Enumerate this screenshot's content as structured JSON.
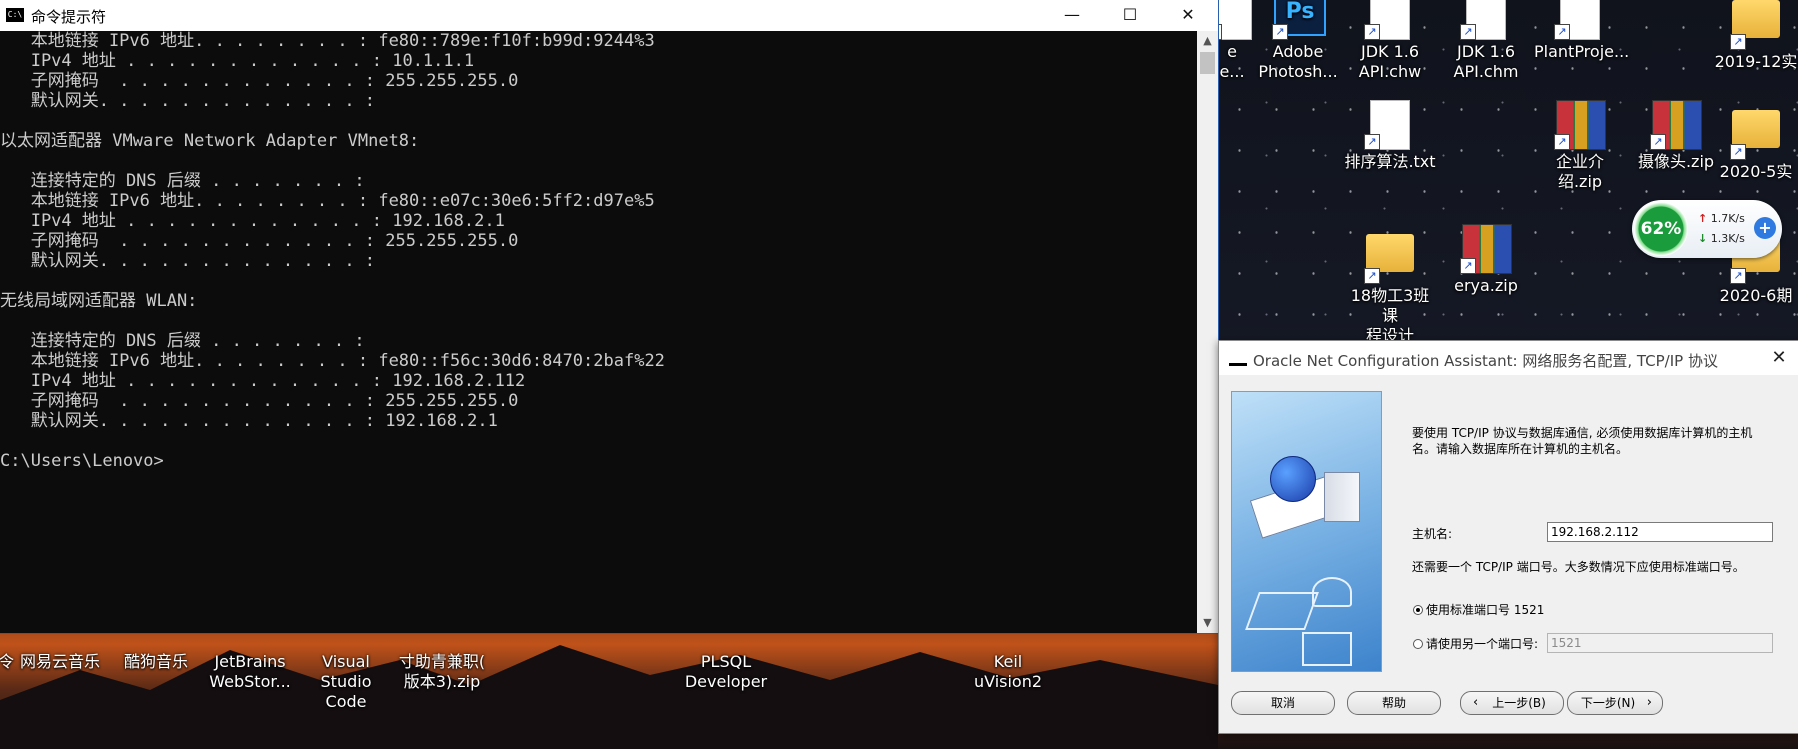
{
  "cmd": {
    "title": "命令提示符",
    "icon_text": "C:\\",
    "controls": {
      "minimize": "—",
      "maximize": "☐",
      "close": "✕"
    },
    "lines": [
      "   本地链接 IPv6 地址. . . . . . . . : fe80::789e:f10f:b99d:9244%3",
      "   IPv4 地址 . . . . . . . . . . . . : 10.1.1.1",
      "   子网掩码  . . . . . . . . . . . . : 255.255.255.0",
      "   默认网关. . . . . . . . . . . . . :",
      "",
      "以太网适配器 VMware Network Adapter VMnet8:",
      "",
      "   连接特定的 DNS 后缀 . . . . . . . :",
      "   本地链接 IPv6 地址. . . . . . . . : fe80::e07c:30e6:5ff2:d97e%5",
      "   IPv4 地址 . . . . . . . . . . . . : 192.168.2.1",
      "   子网掩码  . . . . . . . . . . . . : 255.255.255.0",
      "   默认网关. . . . . . . . . . . . . :",
      "",
      "无线局域网适配器 WLAN:",
      "",
      "   连接特定的 DNS 后缀 . . . . . . . :",
      "   本地链接 IPv6 地址. . . . . . . . : fe80::f56c:30d6:8470:2baf%22",
      "   IPv4 地址 . . . . . . . . . . . . : 192.168.2.112",
      "   子网掩码  . . . . . . . . . . . . : 255.255.255.0",
      "   默认网关. . . . . . . . . . . . . : 192.168.2.1",
      "",
      "C:\\Users\\Lenovo>"
    ]
  },
  "desktop_right": [
    {
      "label": "e\ne...",
      "type": "doc"
    },
    {
      "label": "Adobe\nPhotosh...",
      "type": "ps"
    },
    {
      "label": "JDK 1.6\nAPI.chw",
      "type": "doc"
    },
    {
      "label": "JDK 1.6\nAPI.chm",
      "type": "doc"
    },
    {
      "label": "PlantProje...",
      "type": "doc"
    },
    {
      "label": "2019-12实",
      "type": "folder"
    },
    {
      "label": "排序算法.txt",
      "type": "doc"
    },
    {
      "label": "企业介绍.zip",
      "type": "zip"
    },
    {
      "label": "摄像头.zip",
      "type": "zip"
    },
    {
      "label": "2020-5实",
      "type": "folder"
    },
    {
      "label": "18物工3班课\n程设计",
      "type": "folder"
    },
    {
      "label": "erya.zip",
      "type": "zip"
    },
    {
      "label": "2020-6期",
      "type": "folder"
    }
  ],
  "desktop_bottom": [
    {
      "label": "令"
    },
    {
      "label": "网易云音乐"
    },
    {
      "label": "酷狗音乐"
    },
    {
      "label": "JetBrains\nWebStor..."
    },
    {
      "label": "Visual\nStudio Code"
    },
    {
      "label": "寸助青兼职(\n版本3).zip"
    },
    {
      "label": "PLSQL\nDeveloper"
    },
    {
      "label": "Keil\nuVision2"
    }
  ],
  "network_widget": {
    "percent": "62%",
    "up": "1.7K/s",
    "down": "1.3K/s",
    "plus": "+"
  },
  "dialog": {
    "title": "Oracle Net Configuration Assistant: 网络服务名配置, TCP/IP 协议",
    "close": "✕",
    "intro_line1": "要使用 TCP/IP 协议与数据库通信, 必须使用数据库计算机的主机",
    "intro_line2": "名。请输入数据库所在计算机的主机名。",
    "host_label": "主机名:",
    "host_value": "192.168.2.112",
    "port_note": "还需要一个 TCP/IP 端口号。大多数情况下应使用标准端口号。",
    "radio_standard": "使用标准端口号 1521",
    "radio_other": "请使用另一个端口号:",
    "port_value": "1521",
    "buttons": {
      "cancel": "取消",
      "help": "帮助",
      "back": "上一步(B)",
      "next": "下一步(N)"
    }
  }
}
